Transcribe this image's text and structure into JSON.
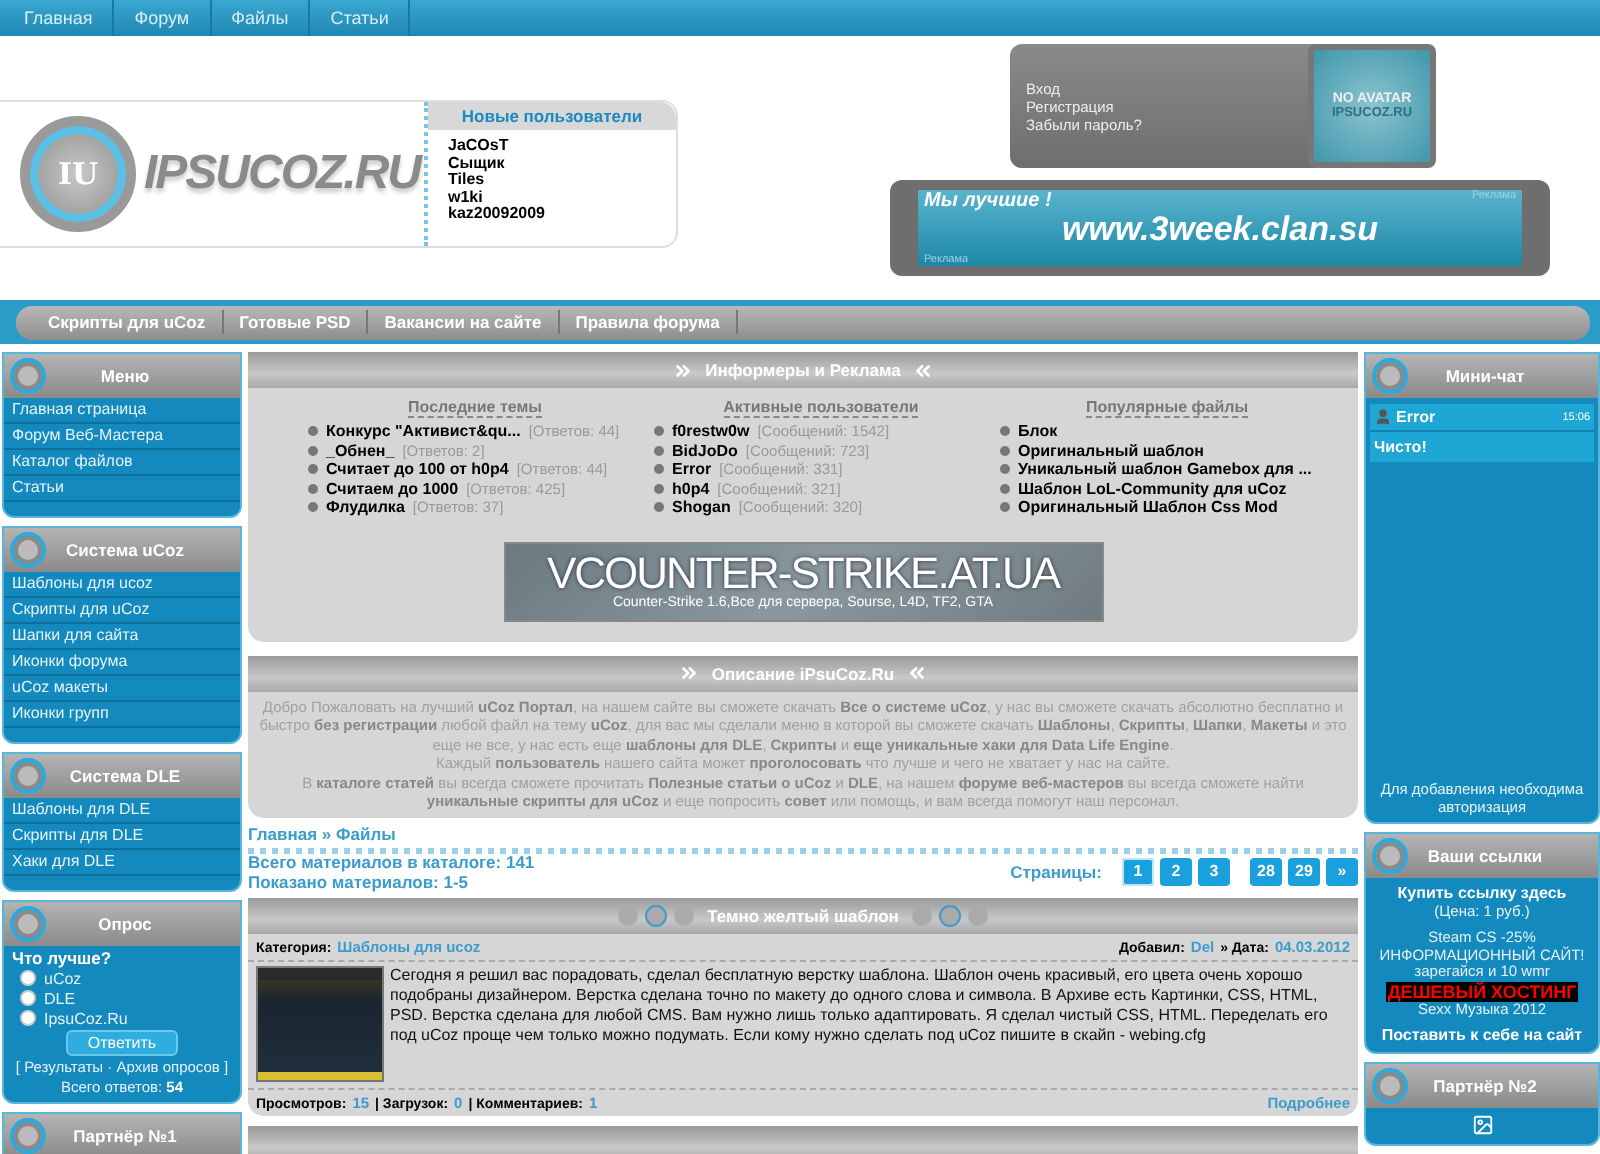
{
  "top_nav": [
    {
      "label": "Главная"
    },
    {
      "label": "Форум"
    },
    {
      "label": "Файлы"
    },
    {
      "label": "Статьи"
    }
  ],
  "logo": {
    "badge": "IU",
    "text": "IPSUCOZ.RU"
  },
  "new_users": {
    "title": "Новые пользователи",
    "users": [
      "JaCOsT",
      "Сыщик",
      "Tiles",
      "w1ki",
      "kaz20092009"
    ]
  },
  "login": {
    "links": [
      "Вход",
      "Регистрация",
      "Забыли пароль?"
    ],
    "avatar": {
      "title": "NO AVATAR",
      "subtitle": "IPSUCOZ.RU"
    }
  },
  "ad_banner": {
    "slogan": "Мы лучшие !",
    "url": "www.3week.clan.su",
    "label_top": "Реклама",
    "label_bottom": "Реклама"
  },
  "sub_nav": [
    {
      "label": "Скрипты для uCoz"
    },
    {
      "label": "Готовые PSD"
    },
    {
      "label": "Вакансии на сайте"
    },
    {
      "label": "Правила форума"
    }
  ],
  "left_blocks": [
    {
      "kind": "menu",
      "title": "Меню",
      "items": [
        "Главная страница",
        "Форум Веб-Мастера",
        "Каталог файлов",
        "Статьи"
      ]
    },
    {
      "kind": "menu",
      "title": "Система uCoz",
      "items": [
        "Шаблоны для ucoz",
        "Скрипты для uCoz",
        "Шапки для сайта",
        "Иконки форума",
        "uCoz макеты",
        "Иконки групп"
      ]
    },
    {
      "kind": "menu",
      "title": "Система DLE",
      "items": [
        "Шаблоны для DLE",
        "Скрипты для DLE",
        "Хаки для DLE"
      ]
    },
    {
      "kind": "poll",
      "title": "Опрос",
      "question": "Что лучше?",
      "options": [
        {
          "label": "uCoz",
          "selected": false
        },
        {
          "label": "DLE",
          "selected": false
        },
        {
          "label": "IpsuCoz.Ru",
          "selected": false
        }
      ],
      "button": "Ответить",
      "links": "[ Результаты · Архив опросов ]",
      "total": "Всего ответов: **54**"
    },
    {
      "kind": "header",
      "title": "Партнёр №1"
    }
  ],
  "informers": {
    "title": "Информеры и Реклама",
    "columns": [
      {
        "title": "Последние темы",
        "items": [
          {
            "name": "Конкурс \"Активист&qu...",
            "note": "[Ответов: 44]"
          },
          {
            "name": "_Обнен_",
            "note": "[Ответов: 2]"
          },
          {
            "name": "Считает до 100 от h0p4",
            "note": "[Ответов: 44]"
          },
          {
            "name": "Считаем до 1000",
            "note": "[Ответов: 425]"
          },
          {
            "name": "Флудилка",
            "note": "[Ответов: 37]"
          }
        ]
      },
      {
        "title": "Активные пользователи",
        "items": [
          {
            "name": "f0restw0w",
            "note": "[Сообщений: 1542]"
          },
          {
            "name": "BidJoDo",
            "note": "[Сообщений: 723]"
          },
          {
            "name": "Error",
            "note": "[Сообщений: 331]"
          },
          {
            "name": "h0p4",
            "note": "[Сообщений: 321]"
          },
          {
            "name": "Shogan",
            "note": "[Сообщений: 320]"
          }
        ]
      },
      {
        "title": "Популярные файлы",
        "items": [
          {
            "name": "Блок"
          },
          {
            "name": "Оригинальный шаблон"
          },
          {
            "name": "Уникальный шаблон Gamebox для ..."
          },
          {
            "name": "Шаблон LoL-Community для uCoz"
          },
          {
            "name": "Оригинальный Шаблон Css Mod"
          }
        ]
      }
    ],
    "banner": {
      "title": "VCOUNTER-STRIKE.AT.UA",
      "caption": "Counter-Strike 1.6,Все для сервера, Sourse, L4D, TF2, GTA"
    }
  },
  "description": {
    "title": "Описание iPsuCoz.Ru",
    "paragraphs": [
      "Добро Пожаловать на лучший **uCoz Портал**, на нашем сайте вы сможете скачать **Все о системе uCoz**, у нас вы сможете скачать абсолютно бесплатно и быстро **без регистрации** любой файл на тему **uCoz**, для вас мы сделали меню в которой вы сможете скачать **Шаблоны**, **Скрипты**, **Шапки**, **Макеты** и это еще не все, у нас есть еще **шаблоны для DLE**, **Скрипты** и **еще уникальные хаки для Data Life Engine**.",
      "Каждый **пользователь** нашего сайта может **проголосовать** что лучше и чего не хватает у нас на сайте.",
      "В **каталоге статей** вы всегда сможете прочитать **Полезные статьи о uCoz** и **DLE**, на нашем **форуме веб-мастеров** вы всегда сможете найти **уникальные скрипты для uCoz** и еще попросить **совет** или помощь, и вам всегда помогут наш персонал."
    ]
  },
  "breadcrumb": "Главная » Файлы",
  "catalog": {
    "total": "Всего материалов в каталоге: 141",
    "shown": "Показано материалов: 1-5"
  },
  "pager": {
    "label": "Страницы:",
    "page_groups": [
      [
        {
          "label": "1",
          "selected": true
        },
        {
          "label": "2",
          "selected": false
        },
        {
          "label": "3",
          "selected": false
        }
      ],
      [
        {
          "label": "28",
          "selected": false
        },
        {
          "label": "29",
          "selected": false
        },
        {
          "label": "»",
          "selected": false
        }
      ]
    ]
  },
  "entry": {
    "title": "Темно желтый шаблон",
    "category_label": "Категория:",
    "category": "Шаблоны для ucoz",
    "meta": [
      {
        "label": "Добавил:",
        "value": "Del"
      },
      {
        "label": "» Дата:",
        "value": "04.03.2012"
      }
    ],
    "text": "Сегодня я решил вас порадовать, сделал бесплатную верстку шаблона. Шаблон очень красивый, его цвета очень хорошо подобраны дизайнером. Верстка сделана точно по макету до одного слова и символа. В Архиве есть Картинки, CSS, HTML, PSD. Верстка сделана для любой CMS. Вам нужно лишь только адаптировать. Я сделал чистый CSS, HTML. Переделать его под uCoz проще чем только можно подумать. Если кому нужно сделать под uCoz пишите в скайп - webing.cfg",
    "stats": [
      {
        "label": "Просмотров:",
        "value": "15"
      },
      {
        "label": "| Загрузок:",
        "value": "0"
      },
      {
        "label": "| Комментариев:",
        "value": "1"
      }
    ],
    "more": "Подробнее"
  },
  "chat": {
    "title": "Мини-чат",
    "messages": [
      {
        "author": "Error",
        "time": "15:06",
        "text": "Чисто!"
      }
    ],
    "footer": "Для добавления необходима авторизация"
  },
  "links_block": {
    "title": "Ваши ссылки",
    "buy": "Купить ссылку здесь",
    "price": "(Цена: 1 руб.)",
    "links": [
      {
        "text": "Steam CS -25%",
        "kind": "plain"
      },
      {
        "text": "ИНФОРМАЦИОННЫЙ САЙТ!",
        "kind": "plain"
      },
      {
        "text": "зарегайся и 10 wmr",
        "kind": "plain"
      },
      {
        "text": "ДЕШЕВЫЙ ХОСТИНГ",
        "kind": "highlight"
      },
      {
        "text": "Sexx Музыка 2012",
        "kind": "plain"
      }
    ],
    "footer": "Поставить к себе на сайт"
  },
  "partner2": {
    "title": "Партнёр №2"
  }
}
